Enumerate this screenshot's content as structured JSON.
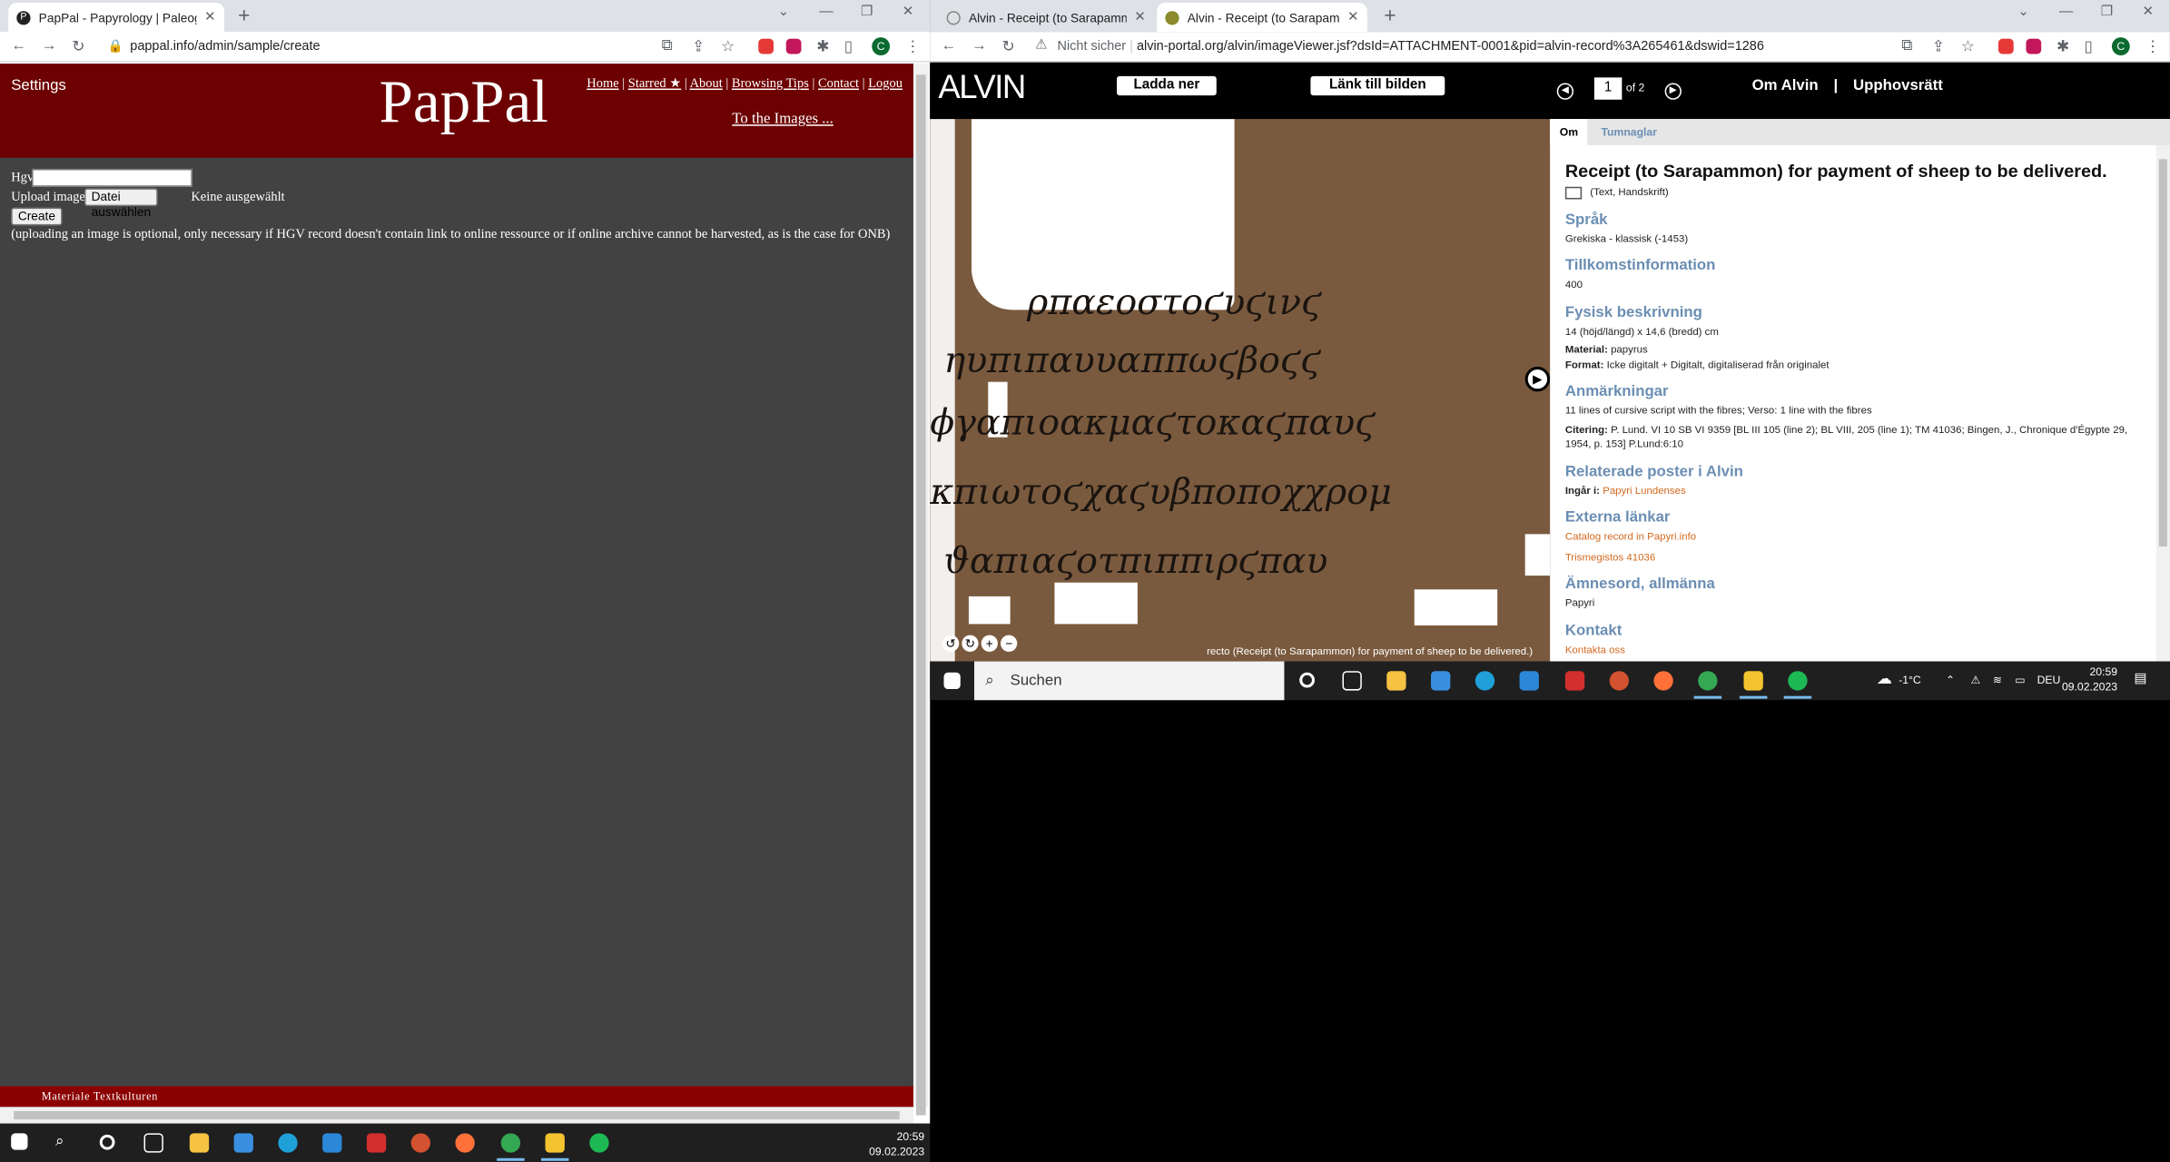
{
  "left_browser": {
    "tab_title": "PapPal - Papyrology | Paleograph",
    "url": "pappal.info/admin/sample/create",
    "page": {
      "settings": "Settings",
      "logo": "PapPal",
      "nav": [
        "Home",
        "Starred ★",
        "About",
        "Browsing Tips",
        "Contact",
        "Logou"
      ],
      "to_images": "To the Images ...",
      "hgv_label": "Hgv",
      "upload_label": "Upload image",
      "choose_file": "Datei auswählen",
      "no_file": "Keine ausgewählt",
      "create_button": "Create",
      "note": "(uploading an image is optional, only necessary if HGV record doesn't contain link to online ressource or if online archive cannot be harvested, as is the case for ONB)",
      "footer": "Materiale Textkulturen"
    }
  },
  "right_browser": {
    "tabs": [
      "Alvin - Receipt (to Sarapammon)",
      "Alvin - Receipt (to Sarapammon)"
    ],
    "url_prefix": "Nicht sicher",
    "url": "alvin-portal.org/alvin/imageViewer.jsf?dsId=ATTACHMENT-0001&pid=alvin-record%3A265461&dswid=1286",
    "header": {
      "logo": "ALVIN",
      "download": "Ladda ner",
      "link": "Länk till bilden",
      "page_current": "1",
      "page_of": "of 2",
      "about": "Om Alvin",
      "sep": "|",
      "copyright": "Upphovsrätt"
    },
    "image_caption": "recto (Receipt (to Sarapammon) for payment of sheep to be delivered.)",
    "sidebar": {
      "tab_about": "Om",
      "tab_thumbs": "Tumnaglar",
      "title": "Receipt (to Sarapammon) for payment of sheep to be delivered.",
      "type": "(Text, Handskrift)",
      "lang_h": "Språk",
      "lang": "Grekiska - klassisk (-1453)",
      "acq_h": "Tillkomstinformation",
      "acq": "400",
      "phys_h": "Fysisk beskrivning",
      "dims": "14 (höjd/längd) x 14,6 (bredd) cm",
      "material_label": "Material:",
      "material": "papyrus",
      "format_label": "Format:",
      "format": "Icke digitalt + Digitalt, digitaliserad från originalet",
      "notes_h": "Anmärkningar",
      "notes": "11 lines of cursive script with the fibres; Verso: 1 line with the fibres",
      "cite_label": "Citering:",
      "cite": "P. Lund. VI 10 SB VI 9359 [BL III 105 (line 2); BL VIII, 205 (line 1); TM 41036; Bingen, J., Chronique d'Égypte 29, 1954, p. 153] P.Lund:6:10",
      "related_h": "Relaterade poster i Alvin",
      "part_label": "Ingår i:",
      "part": "Papyri Lundenses",
      "ext_h": "Externa länkar",
      "ext1": "Catalog record in Papyri.info",
      "ext2": "Trismegistos 41036",
      "subj_h": "Ämnesord, allmänna",
      "subj": "Papyri",
      "contact_h": "Kontakt",
      "contact": "Kontakta oss"
    }
  },
  "taskbar_right": {
    "search": "Suchen",
    "weather": "-1°C",
    "lang": "DEU",
    "time": "20:59",
    "date": "09.02.2023"
  },
  "taskbar_left": {
    "time": "20:59",
    "date": "09.02.2023"
  }
}
